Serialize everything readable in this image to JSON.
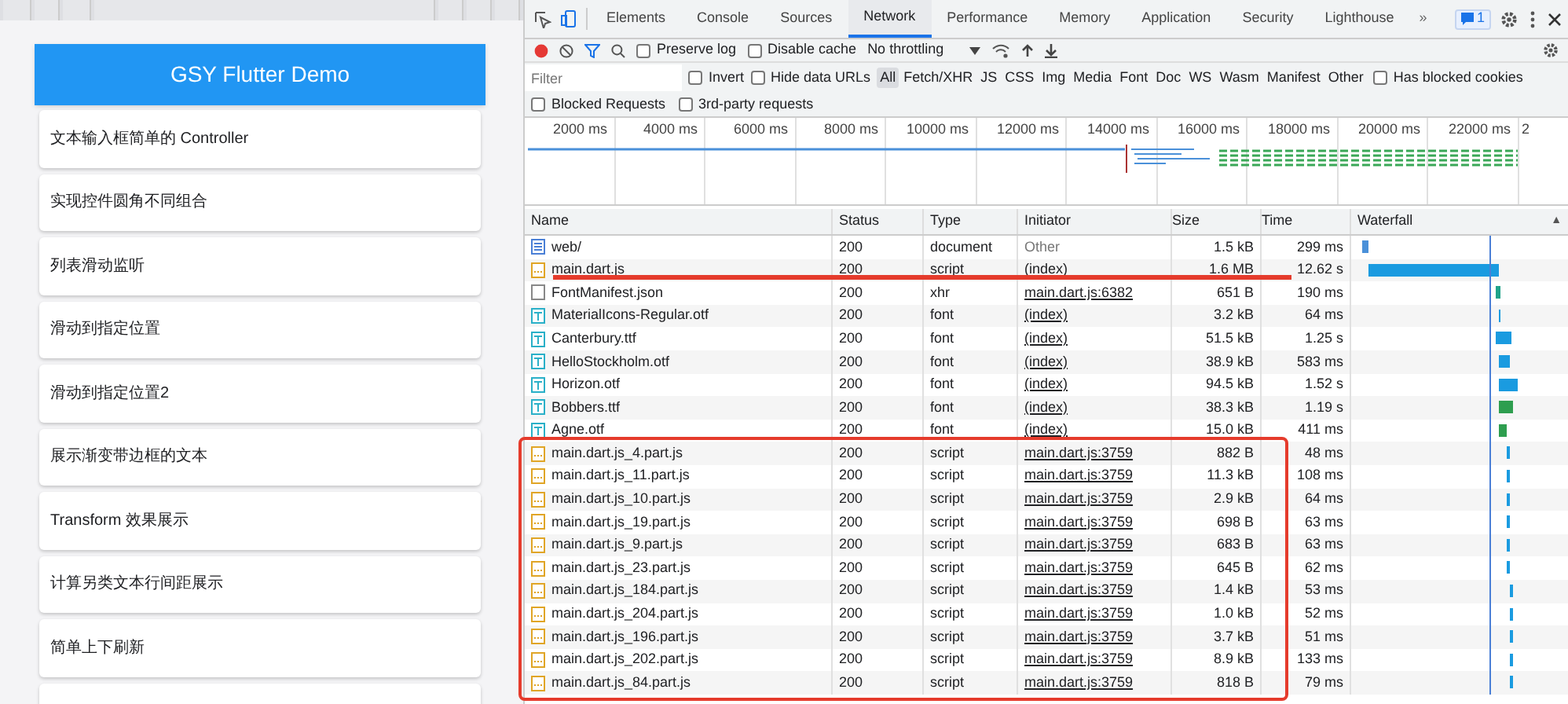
{
  "app": {
    "title": "GSY Flutter Demo",
    "items": [
      "文本输入框简单的 Controller",
      "实现控件圆角不同组合",
      "列表滑动监听",
      "滑动到指定位置",
      "滑动到指定位置2",
      "展示渐变带边框的文本",
      "Transform 效果展示",
      "计算另类文本行间距展示",
      "简单上下刷新"
    ]
  },
  "devtools": {
    "tabs": [
      {
        "label": "Elements",
        "selected": false
      },
      {
        "label": "Console",
        "selected": false
      },
      {
        "label": "Sources",
        "selected": false
      },
      {
        "label": "Network",
        "selected": true
      },
      {
        "label": "Performance",
        "selected": false
      },
      {
        "label": "Memory",
        "selected": false
      },
      {
        "label": "Application",
        "selected": false
      },
      {
        "label": "Security",
        "selected": false
      },
      {
        "label": "Lighthouse",
        "selected": false
      }
    ],
    "more": "»",
    "issues_count": "1",
    "toolbar": {
      "preserve_log": {
        "label": "Preserve log",
        "checked": false
      },
      "disable_cache": {
        "label": "Disable cache",
        "checked": false
      },
      "throttling": "No throttling"
    },
    "filter": {
      "placeholder": "Filter",
      "invert": {
        "label": "Invert",
        "checked": false
      },
      "hide_data_urls": {
        "label": "Hide data URLs",
        "checked": false
      },
      "types": [
        {
          "label": "All",
          "selected": true
        },
        {
          "label": "Fetch/XHR",
          "selected": false
        },
        {
          "label": "JS",
          "selected": false
        },
        {
          "label": "CSS",
          "selected": false
        },
        {
          "label": "Img",
          "selected": false
        },
        {
          "label": "Media",
          "selected": false
        },
        {
          "label": "Font",
          "selected": false
        },
        {
          "label": "Doc",
          "selected": false
        },
        {
          "label": "WS",
          "selected": false
        },
        {
          "label": "Wasm",
          "selected": false
        },
        {
          "label": "Manifest",
          "selected": false
        },
        {
          "label": "Other",
          "selected": false
        }
      ],
      "has_blocked_cookies": {
        "label": "Has blocked cookies",
        "checked": false
      },
      "blocked_requests": {
        "label": "Blocked Requests",
        "checked": false
      },
      "third_party": {
        "label": "3rd-party requests",
        "checked": false
      }
    },
    "overview_ticks": [
      "2000 ms",
      "4000 ms",
      "6000 ms",
      "8000 ms",
      "10000 ms",
      "12000 ms",
      "14000 ms",
      "16000 ms",
      "18000 ms",
      "20000 ms",
      "22000 ms",
      "2"
    ],
    "table": {
      "columns": [
        "Name",
        "Status",
        "Type",
        "Initiator",
        "Size",
        "Time",
        "Waterfall"
      ],
      "sort_indicator": "▲",
      "rows": [
        {
          "kind": "doc",
          "name": "web/",
          "status": "200",
          "type": "document",
          "initiator": "Other",
          "initiator_link": false,
          "size": "1.5 kB",
          "time": "299 ms"
        },
        {
          "kind": "script",
          "name": "main.dart.js",
          "status": "200",
          "type": "script",
          "initiator": "(index)",
          "initiator_link": true,
          "size": "1.6 MB",
          "time": "12.62 s"
        },
        {
          "kind": "blank",
          "name": "FontManifest.json",
          "status": "200",
          "type": "xhr",
          "initiator": "main.dart.js:6382",
          "initiator_link": true,
          "size": "651 B",
          "time": "190 ms"
        },
        {
          "kind": "font",
          "name": "MaterialIcons-Regular.otf",
          "status": "200",
          "type": "font",
          "initiator": "(index)",
          "initiator_link": true,
          "size": "3.2 kB",
          "time": "64 ms"
        },
        {
          "kind": "font",
          "name": "Canterbury.ttf",
          "status": "200",
          "type": "font",
          "initiator": "(index)",
          "initiator_link": true,
          "size": "51.5 kB",
          "time": "1.25 s"
        },
        {
          "kind": "font",
          "name": "HelloStockholm.otf",
          "status": "200",
          "type": "font",
          "initiator": "(index)",
          "initiator_link": true,
          "size": "38.9 kB",
          "time": "583 ms"
        },
        {
          "kind": "font",
          "name": "Horizon.otf",
          "status": "200",
          "type": "font",
          "initiator": "(index)",
          "initiator_link": true,
          "size": "94.5 kB",
          "time": "1.52 s"
        },
        {
          "kind": "font",
          "name": "Bobbers.ttf",
          "status": "200",
          "type": "font",
          "initiator": "(index)",
          "initiator_link": true,
          "size": "38.3 kB",
          "time": "1.19 s"
        },
        {
          "kind": "font",
          "name": "Agne.otf",
          "status": "200",
          "type": "font",
          "initiator": "(index)",
          "initiator_link": true,
          "size": "15.0 kB",
          "time": "411 ms"
        },
        {
          "kind": "script",
          "name": "main.dart.js_4.part.js",
          "status": "200",
          "type": "script",
          "initiator": "main.dart.js:3759",
          "initiator_link": true,
          "size": "882 B",
          "time": "48 ms"
        },
        {
          "kind": "script",
          "name": "main.dart.js_11.part.js",
          "status": "200",
          "type": "script",
          "initiator": "main.dart.js:3759",
          "initiator_link": true,
          "size": "11.3 kB",
          "time": "108 ms"
        },
        {
          "kind": "script",
          "name": "main.dart.js_10.part.js",
          "status": "200",
          "type": "script",
          "initiator": "main.dart.js:3759",
          "initiator_link": true,
          "size": "2.9 kB",
          "time": "64 ms"
        },
        {
          "kind": "script",
          "name": "main.dart.js_19.part.js",
          "status": "200",
          "type": "script",
          "initiator": "main.dart.js:3759",
          "initiator_link": true,
          "size": "698 B",
          "time": "63 ms"
        },
        {
          "kind": "script",
          "name": "main.dart.js_9.part.js",
          "status": "200",
          "type": "script",
          "initiator": "main.dart.js:3759",
          "initiator_link": true,
          "size": "683 B",
          "time": "63 ms"
        },
        {
          "kind": "script",
          "name": "main.dart.js_23.part.js",
          "status": "200",
          "type": "script",
          "initiator": "main.dart.js:3759",
          "initiator_link": true,
          "size": "645 B",
          "time": "62 ms"
        },
        {
          "kind": "script",
          "name": "main.dart.js_184.part.js",
          "status": "200",
          "type": "script",
          "initiator": "main.dart.js:3759",
          "initiator_link": true,
          "size": "1.4 kB",
          "time": "53 ms"
        },
        {
          "kind": "script",
          "name": "main.dart.js_204.part.js",
          "status": "200",
          "type": "script",
          "initiator": "main.dart.js:3759",
          "initiator_link": true,
          "size": "1.0 kB",
          "time": "52 ms"
        },
        {
          "kind": "script",
          "name": "main.dart.js_196.part.js",
          "status": "200",
          "type": "script",
          "initiator": "main.dart.js:3759",
          "initiator_link": true,
          "size": "3.7 kB",
          "time": "51 ms"
        },
        {
          "kind": "script",
          "name": "main.dart.js_202.part.js",
          "status": "200",
          "type": "script",
          "initiator": "main.dart.js:3759",
          "initiator_link": true,
          "size": "8.9 kB",
          "time": "133 ms"
        },
        {
          "kind": "script",
          "name": "main.dart.js_84.part.js",
          "status": "200",
          "type": "script",
          "initiator": "main.dart.js:3759",
          "initiator_link": true,
          "size": "818 B",
          "time": "79 ms"
        }
      ]
    }
  }
}
